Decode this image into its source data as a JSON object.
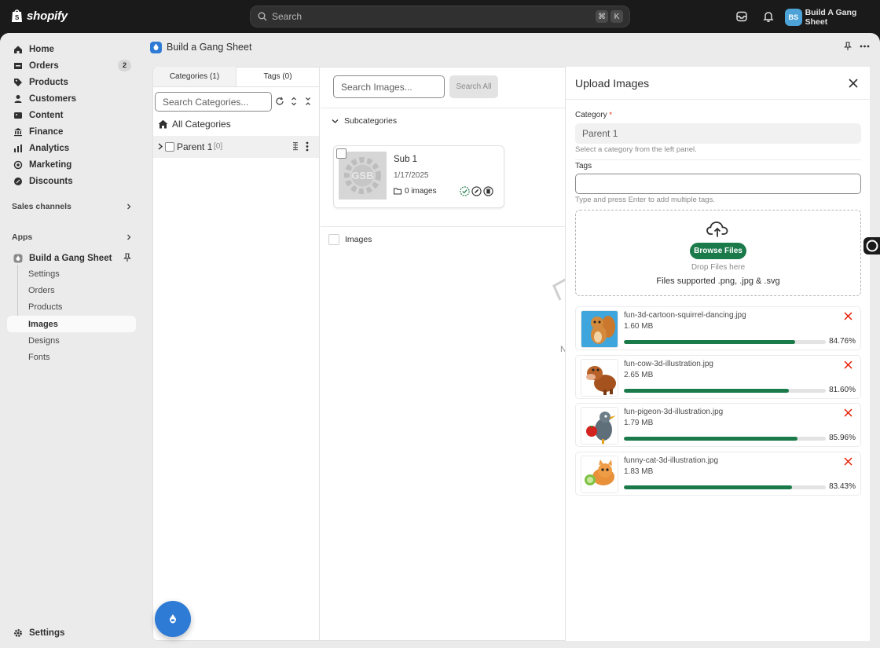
{
  "topbar": {
    "logo_text": "shopify",
    "search_placeholder": "Search",
    "shortcut_keys": [
      "⌘",
      "K"
    ],
    "store_initials": "BS",
    "store_name": "Build A Gang Sheet"
  },
  "sidebar": {
    "items": [
      {
        "label": "Home",
        "icon": "home-icon"
      },
      {
        "label": "Orders",
        "icon": "orders-icon",
        "badge": "2"
      },
      {
        "label": "Products",
        "icon": "tag-icon"
      },
      {
        "label": "Customers",
        "icon": "person-icon"
      },
      {
        "label": "Content",
        "icon": "content-icon"
      },
      {
        "label": "Finance",
        "icon": "finance-icon"
      },
      {
        "label": "Analytics",
        "icon": "analytics-icon"
      },
      {
        "label": "Marketing",
        "icon": "marketing-icon"
      },
      {
        "label": "Discounts",
        "icon": "discount-icon"
      }
    ],
    "sales_channels": "Sales channels",
    "apps": "Apps",
    "app_name": "Build a Gang Sheet",
    "app_sub_items": [
      "Settings",
      "Orders",
      "Products",
      "Images",
      "Designs",
      "Fonts"
    ],
    "active_sub_item": "Images",
    "settings": "Settings"
  },
  "app_header": {
    "title": "Build a Gang Sheet"
  },
  "categories_panel": {
    "tabs": [
      "Categories (1)",
      "Tags (0)"
    ],
    "search_placeholder": "Search Categories...",
    "all_categories": "All Categories",
    "rows": [
      {
        "label": "Parent 1",
        "count": "[0]"
      }
    ]
  },
  "images_panel": {
    "search_placeholder": "Search Images...",
    "search_all": "Search All",
    "subcategories_label": "Subcategories",
    "subcategory": {
      "name": "Sub 1",
      "date": "1/17/2025",
      "images": "0 images"
    },
    "images_label": "Images",
    "empty_fragment": "N"
  },
  "upload_modal": {
    "title": "Upload Images",
    "category_label": "Category",
    "required_mark": "*",
    "category_value": "Parent 1",
    "category_help": "Select a category from the left panel.",
    "tags_label": "Tags",
    "tags_help": "Type and press Enter to add multiple tags.",
    "browse_files": "Browse Files",
    "drop_text": "Drop Files here",
    "supported": "Files supported .png, .jpg & .svg",
    "files": [
      {
        "name": "fun-3d-cartoon-squirrel-dancing.jpg",
        "size": "1.60 MB",
        "progress": 84.76,
        "progress_label": "84.76%"
      },
      {
        "name": "fun-cow-3d-illustration.jpg",
        "size": "2.65 MB",
        "progress": 81.6,
        "progress_label": "81.60%"
      },
      {
        "name": "fun-pigeon-3d-illustration.jpg",
        "size": "1.79 MB",
        "progress": 85.96,
        "progress_label": "85.96%"
      },
      {
        "name": "funny-cat-3d-illustration.jpg",
        "size": "1.83 MB",
        "progress": 83.43,
        "progress_label": "83.43%"
      }
    ]
  },
  "colors": {
    "accent_green": "#1b7a4a",
    "app_blue": "#2e7bd6",
    "close_red": "#e51c00"
  }
}
